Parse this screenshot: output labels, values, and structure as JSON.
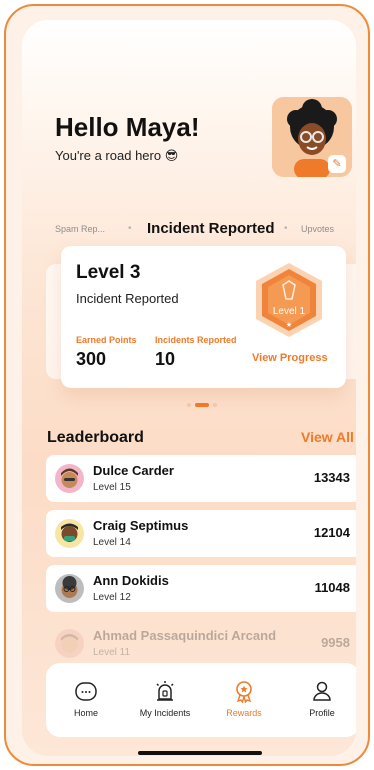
{
  "greeting": {
    "title": "Hello Maya!",
    "subtitle": "You're a road hero 😎"
  },
  "tabs": {
    "left": "Spam Rep...",
    "active": "Incident Reported",
    "right": "Upvotes"
  },
  "card": {
    "level": "Level 3",
    "subtitle": "Incident Reported",
    "earned_label": "Earned Points",
    "earned_value": "300",
    "incidents_label": "Incidents Reported",
    "incidents_value": "10",
    "badge_label": "Level 1",
    "view_progress": "View Progress"
  },
  "leaderboard": {
    "title": "Leaderboard",
    "view_all": "View All",
    "rows": [
      {
        "name": "Dulce Carder",
        "level": "Level 15",
        "score": "13343"
      },
      {
        "name": "Craig Septimus",
        "level": "Level 14",
        "score": "12104"
      },
      {
        "name": "Ann Dokidis",
        "level": "Level 12",
        "score": "11048"
      },
      {
        "name": "Ahmad Passaquindici Arcand",
        "level": "Level 11",
        "score": "9958"
      }
    ]
  },
  "nav": {
    "items": [
      {
        "label": "Home",
        "icon": "home-icon"
      },
      {
        "label": "My Incidents",
        "icon": "siren-icon"
      },
      {
        "label": "Rewards",
        "icon": "rewards-icon"
      },
      {
        "label": "Profile",
        "icon": "profile-icon"
      }
    ],
    "active": "Rewards"
  },
  "colors": {
    "accent": "#ef7a2a",
    "frame": "#ef8a3a"
  }
}
